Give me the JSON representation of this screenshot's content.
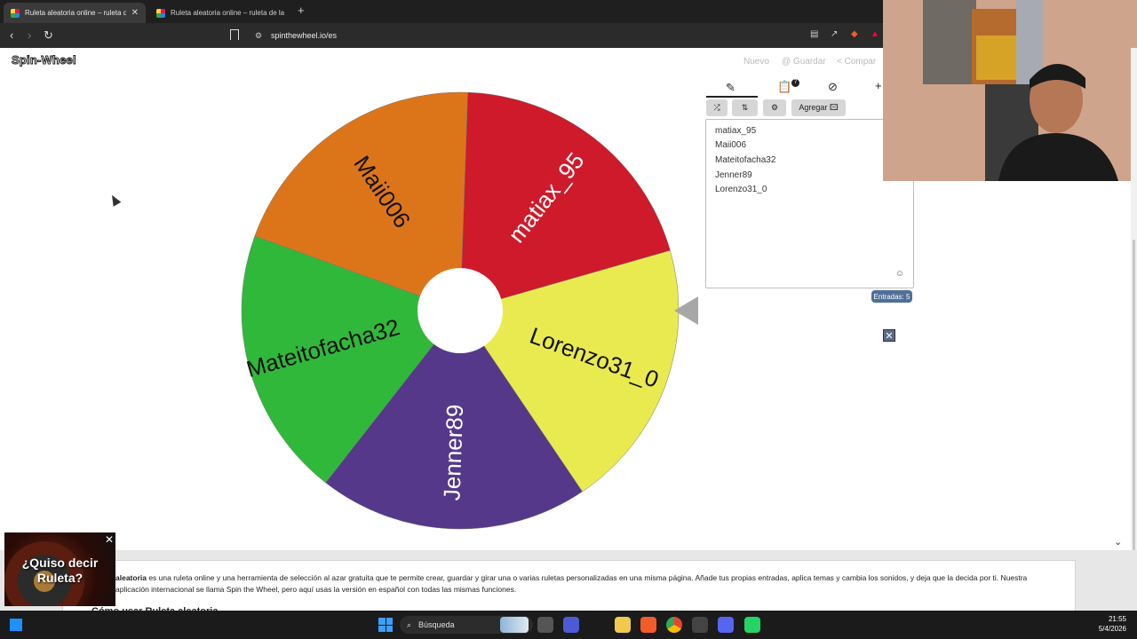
{
  "browser": {
    "tabs": [
      {
        "title": "Ruleta aleatoria online – ruleta d"
      },
      {
        "title": "Ruleta aleatoria online – ruleta de la"
      }
    ],
    "url": "spinthewheel.io/es"
  },
  "app": {
    "logo": "Spin-Wheel",
    "actions": {
      "new": "Nuevo",
      "save": "@ Guardar",
      "share": "< Compar"
    }
  },
  "wheel": {
    "segments": [
      {
        "label": "matiax_95",
        "color": "#ce1a2a"
      },
      {
        "label": "Lorenzo31_0",
        "color": "#e9ea4f"
      },
      {
        "label": "Jenner89",
        "color": "#55388a"
      },
      {
        "label": "Mateitofacha32",
        "color": "#30b83a"
      },
      {
        "label": "Maii006",
        "color": "#dc751a"
      }
    ]
  },
  "panel": {
    "tabs": {
      "edit": "✎",
      "results_badge": "7",
      "hide": "⊘",
      "add": "+"
    },
    "buttons": {
      "shuffle": "⤮",
      "sort": "⇅",
      "settings": "⚙",
      "add_image": "Agregar 🖾"
    },
    "entries": [
      "matiax_95",
      "Maii006",
      "Mateitofacha32",
      "Jenner89",
      "Lorenzo31_0"
    ],
    "count_label": "Entradas: 5"
  },
  "content": {
    "paragraph_bold": "aleatoria",
    "paragraph": " es una ruleta online y una herramienta de selección al azar gratuita que te permite crear, guardar y girar una o varias ruletas personalizadas en una misma página. Añade tus propias entradas, aplica temas y cambia los sonidos, y deja que la decida por ti. Nuestra aplicación internacional se llama Spin the Wheel, pero aquí usas la versión en español con todas las mismas funciones.",
    "heading": "Cómo usar Ruleta aleatoria"
  },
  "ad": {
    "text": "¿Quiso decir Ruleta?"
  },
  "taskbar": {
    "search_label": "Búsqueda",
    "time": "21:55",
    "date": "5/4/2026"
  }
}
